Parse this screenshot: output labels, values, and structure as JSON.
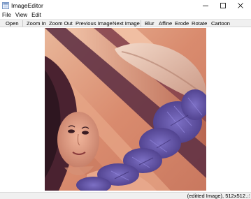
{
  "window": {
    "title": "ImageEditor"
  },
  "menu": {
    "items": [
      "File",
      "View",
      "Edit"
    ]
  },
  "toolbar": {
    "buttons": [
      "Open",
      "Zoom In",
      "Zoom Out",
      "Previous Image",
      "Next Image",
      "Blur",
      "Affine",
      "Erode",
      "Rotate",
      "Cartoon"
    ]
  },
  "status": {
    "text": "(editted Image), 512x512"
  },
  "colors": {
    "toolbar_bg": "#f0f0f0",
    "status_bg": "#f0f0f0",
    "image_peach": "#e8a98a",
    "image_plum": "#5a2f4a",
    "image_feather": "#6a5fb0"
  }
}
